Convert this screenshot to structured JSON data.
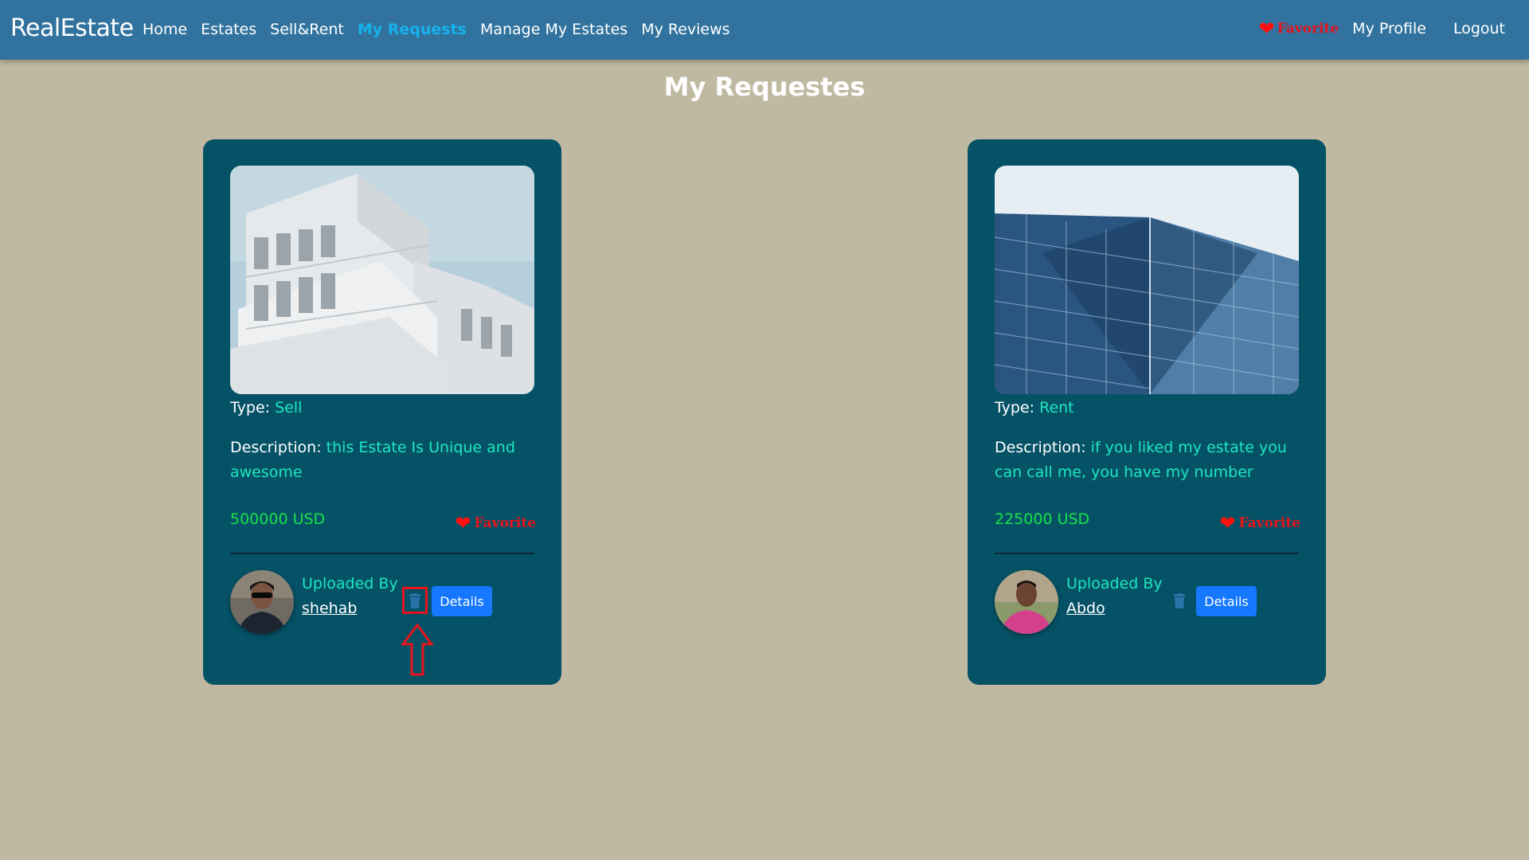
{
  "navbar": {
    "brand": "RealEstate",
    "links": [
      "Home",
      "Estates",
      "Sell&Rent",
      "My Requests",
      "Manage My Estates",
      "My Reviews"
    ],
    "active_index": 3,
    "favorite_label": "Favorite",
    "profile_label": "My Profile",
    "logout_label": "Logout"
  },
  "page_title": "My Requestes",
  "cards": [
    {
      "type_label": "Type:",
      "type_value": "Sell",
      "desc_label": "Description:",
      "desc_value": "this Estate Is Unique and awesome",
      "price": "500000 USD",
      "favorite_label": "Favorite",
      "uploaded_label": "Uploaded By",
      "uploader": "shehab",
      "details_label": "Details",
      "image": "white-modern-building",
      "highlighted_delete": true
    },
    {
      "type_label": "Type:",
      "type_value": "Rent",
      "desc_label": "Description:",
      "desc_value": "if you liked my estate you can call me, you have my number",
      "price": "225000 USD",
      "favorite_label": "Favorite",
      "uploaded_label": "Uploaded By",
      "uploader": "Abdo",
      "details_label": "Details",
      "image": "glass-skyscraper",
      "highlighted_delete": false
    }
  ],
  "colors": {
    "navbar": "#31739e",
    "background": "#c0b9a1",
    "card": "#055266",
    "accent": "#1ee6bf",
    "price": "#19e04b",
    "favorite": "#e8131b",
    "active_link": "#16b2ec",
    "button": "#1677ff",
    "annotation": "#e8131b"
  }
}
